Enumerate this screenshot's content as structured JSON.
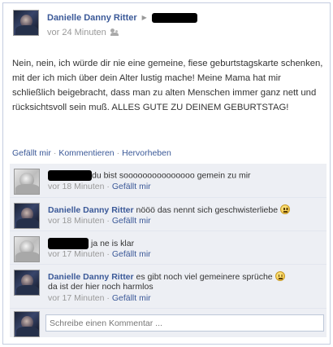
{
  "post": {
    "author": "Danielle Danny Ritter",
    "timestamp": "vor 24 Minuten",
    "audience_icon": "people-icon",
    "message": "Nein, nein, ich würde dir nie eine gemeine, fiese geburtstagskarte schenken, mit der ich mich über dein Alter lustig mache! Meine Mama hat mir schließlich beigebracht, dass man zu alten Menschen immer ganz nett und rücksichtsvoll sein muß. ALLES GUTE ZU DEINEM GEBURTSTAG!",
    "actions": {
      "like": "Gefällt mir",
      "comment": "Kommentieren",
      "highlight": "Hervorheben",
      "separator": "·"
    }
  },
  "comments": [
    {
      "author": "",
      "text": "du bist sooooooooooooooo gemein zu mir",
      "time": "vor 18 Minuten",
      "like": "Gefällt mir",
      "separator": "·"
    },
    {
      "author": "Danielle Danny Ritter",
      "text": "nööö das nennt sich geschwisterliebe",
      "time": "vor 18 Minuten",
      "like": "Gefällt mir",
      "separator": "·"
    },
    {
      "author": "",
      "text": "ja ne is klar",
      "time": "vor 17 Minuten",
      "like": "Gefällt mir",
      "separator": "·"
    },
    {
      "author": "Danielle Danny Ritter",
      "text": "es gibt noch viel gemeinere sprüche",
      "text2": "da ist der hier noch harmlos",
      "time": "vor 17 Minuten",
      "like": "Gefällt mir",
      "separator": "·"
    }
  ],
  "composer": {
    "placeholder": "Schreibe einen Kommentar ..."
  },
  "colors": {
    "link": "#3b5998",
    "comment_bg": "#edeff4",
    "meta": "#999999"
  }
}
